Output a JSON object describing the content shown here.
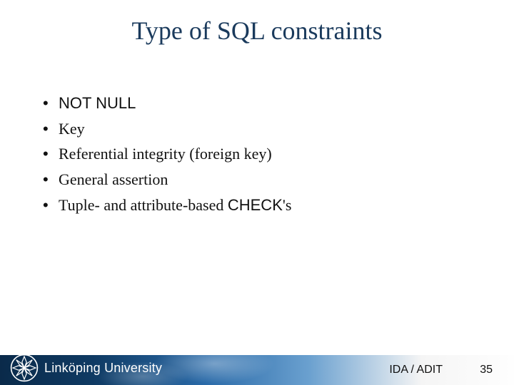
{
  "title": "Type of SQL constraints",
  "bullets": [
    {
      "pre": "NOT NULL",
      "post": ""
    },
    {
      "pre": "",
      "post": "Key"
    },
    {
      "pre": "",
      "post": "Referential integrity (foreign key)"
    },
    {
      "pre": "",
      "post": "General assertion"
    },
    {
      "pre": "",
      "post_a": "Tuple- and attribute-based ",
      "post_b": "CHECK",
      "post_c": "'s"
    }
  ],
  "footer": {
    "org": "Linköping University",
    "label": "IDA / ADIT",
    "page": "35"
  }
}
